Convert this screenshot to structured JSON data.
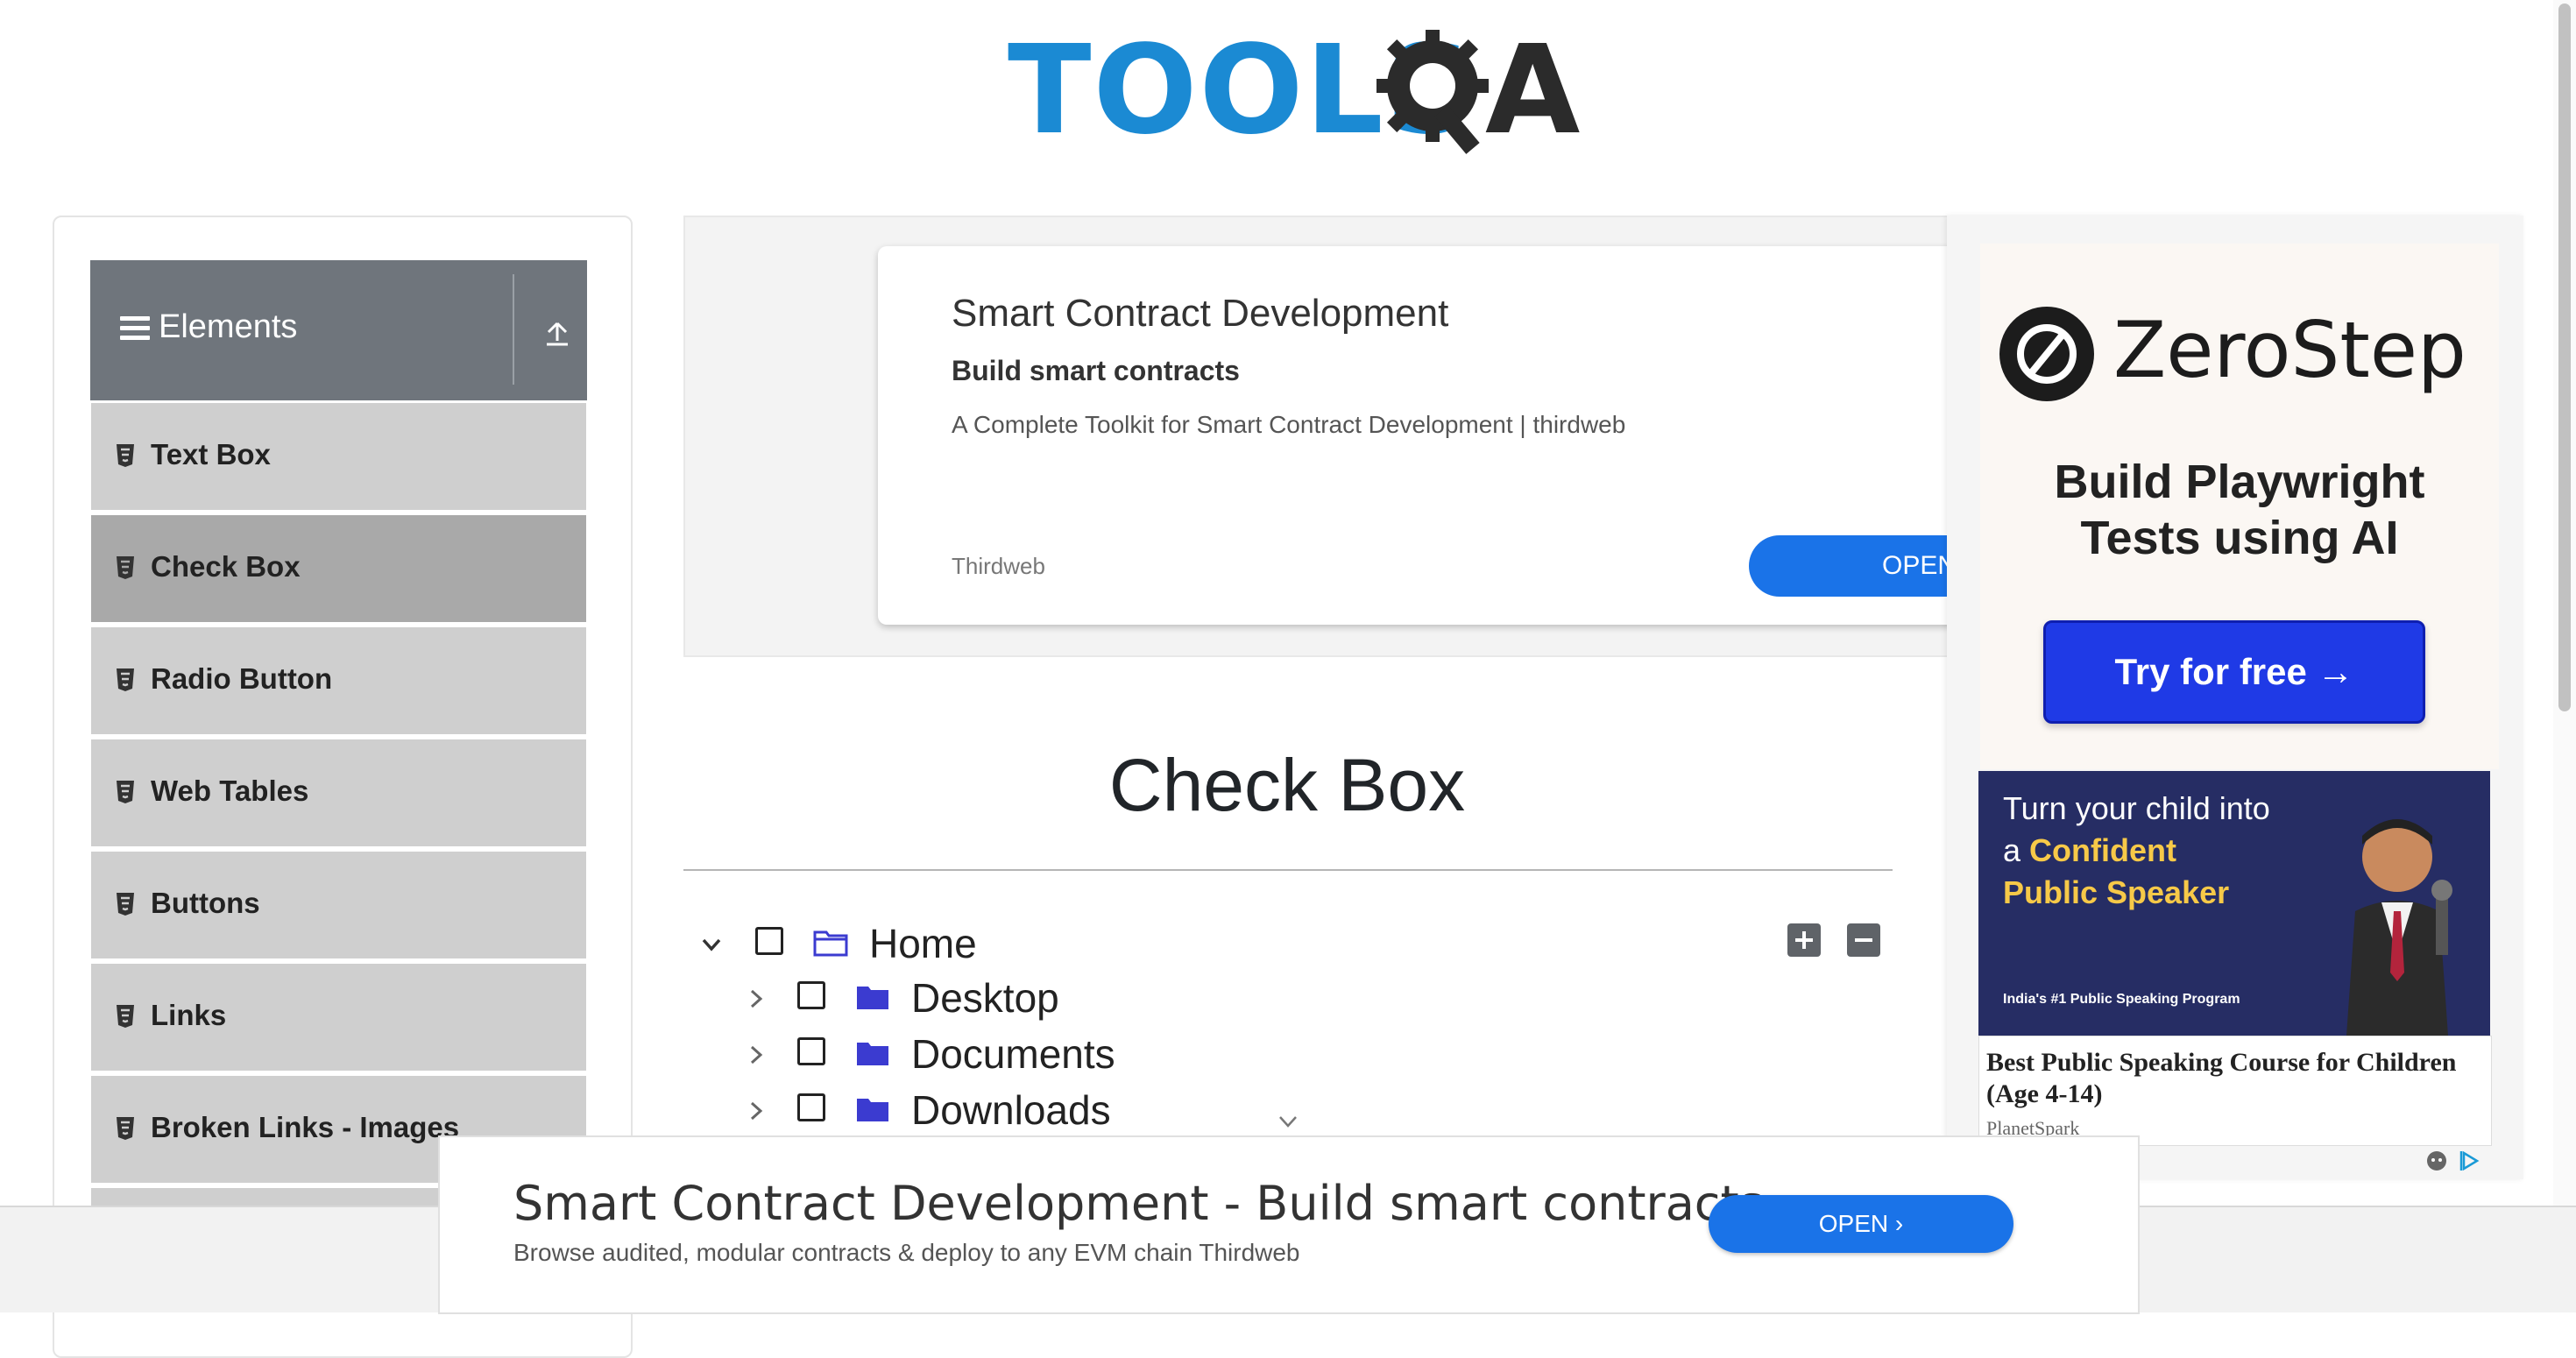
{
  "header": {
    "logo_text_a": "TOOLS",
    "logo_text_b": "A",
    "logo_icon": "gear-magnifier-icon"
  },
  "sidebar": {
    "group_title": "Elements",
    "items": [
      {
        "label": "Text Box"
      },
      {
        "label": "Check Box",
        "active": true
      },
      {
        "label": "Radio Button"
      },
      {
        "label": "Web Tables"
      },
      {
        "label": "Buttons"
      },
      {
        "label": "Links"
      },
      {
        "label": "Broken Links - Images"
      }
    ]
  },
  "top_ad": {
    "title": "Smart Contract Development",
    "subtitle": "Build smart contracts",
    "description": "A Complete Toolkit for Smart Contract Development | thirdweb",
    "brand": "Thirdweb",
    "button": "OPEN"
  },
  "main": {
    "page_title": "Check Box",
    "tree": [
      {
        "label": "Home",
        "expanded": true,
        "level": 0
      },
      {
        "label": "Desktop",
        "expanded": false,
        "level": 1
      },
      {
        "label": "Documents",
        "expanded": false,
        "level": 1
      },
      {
        "label": "Downloads",
        "expanded": false,
        "level": 1
      }
    ]
  },
  "right_ad": {
    "brand": "ZeroStep",
    "headline_1": "Build Playwright",
    "headline_2": "Tests using AI",
    "cta": "Try for free →",
    "banner_line1": "Turn your child into",
    "banner_line2_a": "a ",
    "banner_line2_b": "Confident",
    "banner_line3": "Public Speaker",
    "banner_tag": "India's #1 Public Speaking Program",
    "card_title": "Best Public Speaking Course for Children (Age 4-14)",
    "card_brand": "PlanetSpark"
  },
  "bottom_ad": {
    "title": "Smart Contract Development - Build smart contracts",
    "description": "Browse audited, modular contracts & deploy to any EVM chain Thirdweb",
    "button": "OPEN ›"
  },
  "colors": {
    "accent": "#1a73e8",
    "sidebar_header": "#6f757c",
    "sidebar_item": "#cfcfcf",
    "sidebar_active": "#a9a9a9",
    "folder": "#3b3bd0"
  }
}
